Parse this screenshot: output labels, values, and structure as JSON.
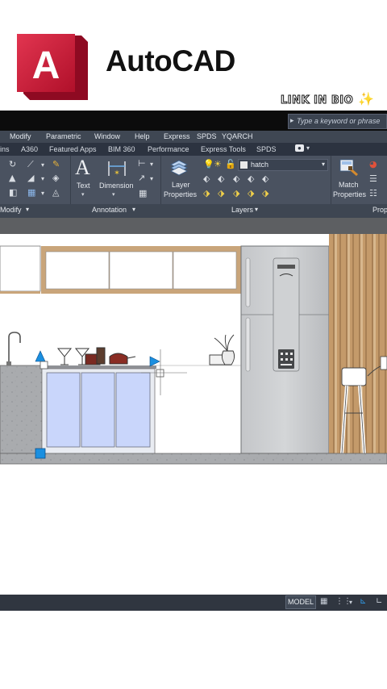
{
  "header": {
    "logo_letter": "A",
    "brand": "AutoCAD",
    "link_in_bio": "LINK IN BIO",
    "sparkle": "✨"
  },
  "titlebar": {
    "search_placeholder": "Type a keyword or phrase"
  },
  "menu": [
    "Modify",
    "Parametric",
    "Window",
    "Help",
    "Express",
    "SPDS",
    "YQARCH"
  ],
  "tabs": [
    "ins",
    "A360",
    "Featured Apps",
    "BIM 360",
    "Performance",
    "Express Tools",
    "SPDS"
  ],
  "ribbon": {
    "text_label": "Text",
    "dimension_label": "Dimension",
    "layer_properties_label": [
      "Layer",
      "Properties"
    ],
    "match_properties_label": [
      "Match",
      "Properties"
    ],
    "layer_current": "hatch",
    "panels": {
      "modify": "Modify",
      "annotation": "Annotation",
      "layers": "Layers",
      "properties": "Prop"
    }
  },
  "status": {
    "model": "MODEL"
  },
  "colors": {
    "autocad_red": "#c8102e",
    "titlebar": "#0c0c0c",
    "ribbon": "#4a5260",
    "grip": "#1a8fe0",
    "cabinet_hatch": "#c9d6fb",
    "wood_trim": "#b98a58"
  }
}
